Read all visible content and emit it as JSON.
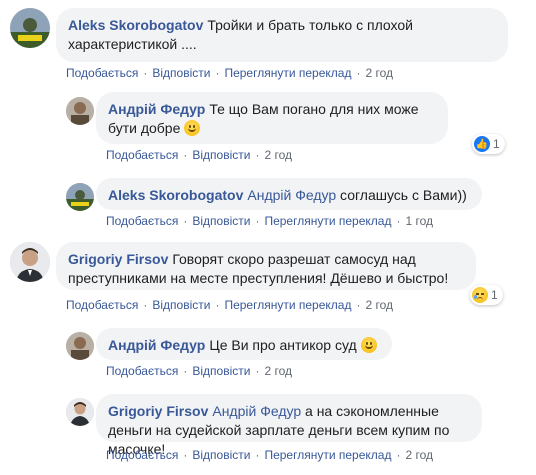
{
  "comments": [
    {
      "author": "Aleks Skorobogatov",
      "text": "Тройки и брать только с плохой характеристикой ....",
      "actions": {
        "like": "Подобається",
        "reply": "Відповісти",
        "translate": "Переглянути переклад",
        "time": "2 год"
      }
    },
    {
      "author": "Андрій Федур",
      "text": "Те що Вам погано для них може бути добре",
      "emoji": "smile-emoji",
      "actions": {
        "like": "Подобається",
        "reply": "Відповісти",
        "time": "2 год"
      },
      "reaction": {
        "icon": "like-icon",
        "count": "1"
      }
    },
    {
      "author": "Aleks Skorobogatov",
      "mention": "Андрій Федур",
      "text": "соглашусь с Вами))",
      "actions": {
        "like": "Подобається",
        "reply": "Відповісти",
        "translate": "Переглянути переклад",
        "time": "1 год"
      }
    },
    {
      "author": "Grigoriy Firsov",
      "text": "Говорят скоро разрешат самосуд над преступниками на месте преступления! Дёшево и быстро!",
      "actions": {
        "like": "Подобається",
        "reply": "Відповісти",
        "translate": "Переглянути переклад",
        "time": "2 год"
      },
      "reaction": {
        "icon": "sad-icon",
        "count": "1"
      }
    },
    {
      "author": "Андрій Федур",
      "text": "Це Ви про антикор суд",
      "emoji": "smile-emoji",
      "actions": {
        "like": "Подобається",
        "reply": "Відповісти",
        "time": "2 год"
      }
    },
    {
      "author": "Grigoriy Firsov",
      "mention": "Андрій Федур",
      "text": "а на сэкономленные деньги на судейской зарплате деньги всем купим по масочке!",
      "actions": {
        "like": "Подобається",
        "reply": "Відповісти",
        "translate": "Переглянути переклад",
        "time": "2 год"
      }
    }
  ],
  "colors": {
    "link": "#385898",
    "bubble": "#f2f3f5",
    "meta": "#606770"
  }
}
